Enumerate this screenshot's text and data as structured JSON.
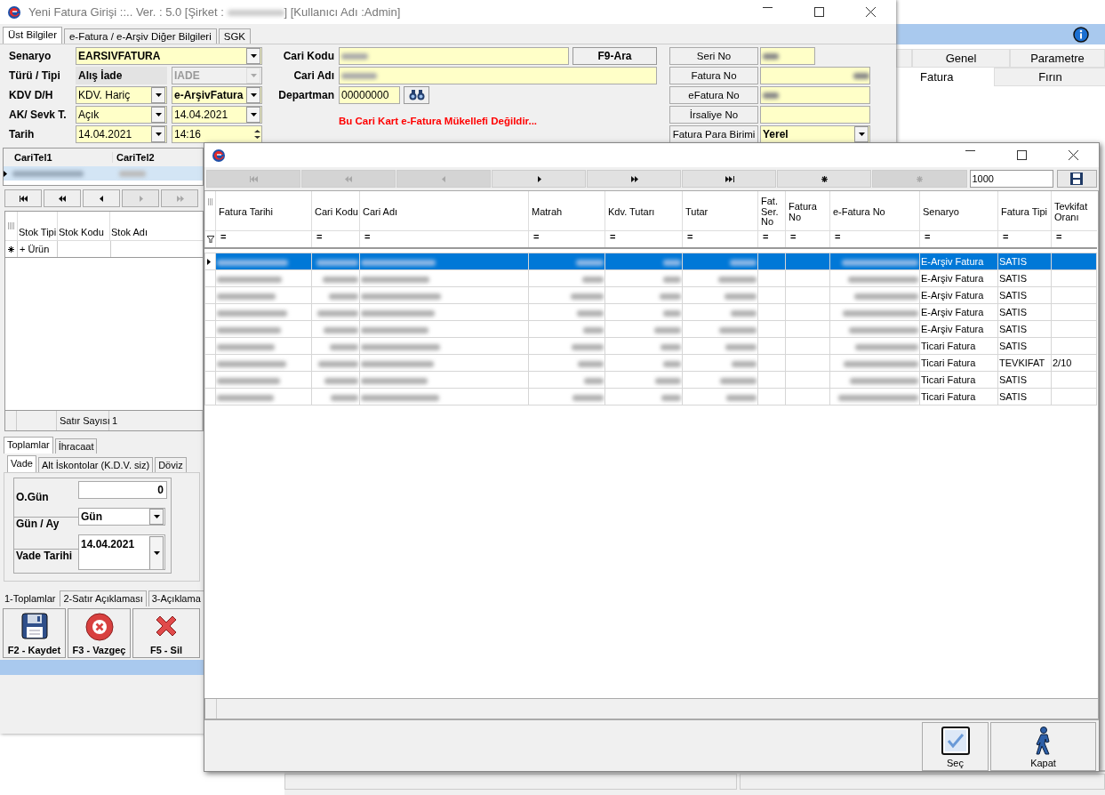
{
  "main_window": {
    "title_prefix": "Yeni Fatura Girişi ::.. Ver. : 5.0 [Şirket : ",
    "title_suffix": "] [Kullanıcı Adı :Admin]",
    "tabs": [
      {
        "label": "Üst Bilgiler",
        "selected": true
      },
      {
        "label": "e-Fatura / e-Arşiv Diğer Bilgileri",
        "selected": false
      },
      {
        "label": "SGK",
        "selected": false
      }
    ],
    "form_left": [
      {
        "label": "Senaryo",
        "fields": [
          {
            "kind": "combo",
            "value": "EARSIVFATURA",
            "disabled": false
          }
        ]
      },
      {
        "label": "Türü / Tipi",
        "fields": [
          {
            "kind": "readonly",
            "value": "Alış İade",
            "disabled": false
          },
          {
            "kind": "combo",
            "value": "IADE",
            "disabled": true
          }
        ]
      },
      {
        "label": "KDV D/H",
        "fields": [
          {
            "kind": "combo",
            "value": "KDV. Hariç",
            "disabled": false
          },
          {
            "kind": "combo",
            "value": "e-ArşivFatura",
            "disabled": false
          }
        ]
      },
      {
        "label": "AK/ Sevk T.",
        "fields": [
          {
            "kind": "combo",
            "value": "Açık",
            "disabled": false
          },
          {
            "kind": "combo",
            "value": "14.04.2021",
            "disabled": false
          }
        ]
      },
      {
        "label": "Tarih",
        "fields": [
          {
            "kind": "combo",
            "value": "14.04.2021",
            "disabled": false
          },
          {
            "kind": "spin",
            "value": "14:16",
            "disabled": false
          }
        ]
      }
    ],
    "form_middle": {
      "cari_kodu_label": "Cari Kodu",
      "search_button": "F9-Ara",
      "cari_adi_label": "Cari Adı",
      "departman_label": "Departman",
      "departman_value": "00000000",
      "warning": "Bu Cari Kart e-Fatura Mükellefi Değildir..."
    },
    "form_right": [
      {
        "label": "Seri No",
        "kind": "blurred"
      },
      {
        "label": "Fatura No",
        "kind": "blurred"
      },
      {
        "label": "eFatura No",
        "kind": "blurred"
      },
      {
        "label": "İrsaliye No",
        "kind": "empty"
      },
      {
        "label": "Fatura Para Birimi",
        "kind": "combo",
        "value": "Yerel"
      }
    ],
    "cari_grid": {
      "columns": [
        "CariTel1",
        "CariTel2"
      ]
    },
    "nav": [
      {
        "kind": "first",
        "disabled": false
      },
      {
        "kind": "prev_page",
        "disabled": false
      },
      {
        "kind": "prev",
        "disabled": false
      },
      {
        "kind": "next",
        "disabled": true
      },
      {
        "kind": "next_page",
        "disabled": true
      }
    ],
    "stock_grid": {
      "columns": [
        "Stok Tipi",
        "Stok Kodu",
        "Stok Adı"
      ],
      "new_row": "+ Ürün",
      "footer_label": "Satır Sayısı",
      "footer_value": "1"
    },
    "totals_tabs": [
      {
        "label": "Toplamlar",
        "selected": true
      },
      {
        "label": "İhracaat",
        "selected": false
      }
    ],
    "vade_tabs": [
      {
        "label": "Vade",
        "selected": true
      },
      {
        "label": "Alt İskontolar (K.D.V. siz)",
        "selected": false
      },
      {
        "label": "Döviz",
        "selected": false
      }
    ],
    "vade_form": {
      "o_gun_label": "O.Gün",
      "o_gun_value": "0",
      "gun_ay_label": "Gün / Ay",
      "gun_ay_value": "Gün",
      "vade_tarihi_label": "Vade Tarihi",
      "vade_tarihi_value": "14.04.2021"
    },
    "bottom_tabs": [
      {
        "label": "1-Toplamlar",
        "selected": true
      },
      {
        "label": "2-Satır Açıklaması",
        "selected": false
      },
      {
        "label": "3-Açıklama",
        "selected": false
      }
    ],
    "actions": [
      {
        "kind": "save",
        "label": "F2 - Kaydet"
      },
      {
        "kind": "cancel",
        "label": "F3 - Vazgeç"
      },
      {
        "kind": "delete",
        "label": "F5 - Sil"
      }
    ]
  },
  "dialog": {
    "nav": [
      {
        "kind": "first",
        "disabled": true
      },
      {
        "kind": "prev_page",
        "disabled": true
      },
      {
        "kind": "prev",
        "disabled": true
      },
      {
        "kind": "next",
        "disabled": false
      },
      {
        "kind": "next_page",
        "disabled": false
      },
      {
        "kind": "last",
        "disabled": false
      },
      {
        "kind": "insert",
        "disabled": false
      },
      {
        "kind": "cancel",
        "disabled": true
      }
    ],
    "page_size": "1000",
    "columns": [
      {
        "label": "Fatura Tarihi",
        "filter": "="
      },
      {
        "label": "Cari Kodu",
        "filter": "="
      },
      {
        "label": "Cari Adı",
        "filter": "="
      },
      {
        "label": "Matrah",
        "filter": "="
      },
      {
        "label": "Kdv. Tutarı",
        "filter": "="
      },
      {
        "label": "Tutar",
        "filter": "="
      },
      {
        "label": "Fat. Ser. No",
        "filter": "="
      },
      {
        "label": "Fatura No",
        "filter": "="
      },
      {
        "label": "e-Fatura No",
        "filter": "="
      },
      {
        "label": "Senaryo",
        "filter": "="
      },
      {
        "label": "Fatura Tipi",
        "filter": "="
      },
      {
        "label": "Tevkifat Oranı",
        "filter": "="
      }
    ],
    "rows": [
      {
        "selected": true,
        "senaryo": "E-Arşiv Fatura",
        "fatura_tipi": "SATIS"
      },
      {
        "selected": false,
        "senaryo": "E-Arşiv Fatura",
        "fatura_tipi": "SATIS"
      },
      {
        "selected": false,
        "senaryo": "E-Arşiv Fatura",
        "fatura_tipi": "SATIS"
      },
      {
        "selected": false,
        "senaryo": "E-Arşiv Fatura",
        "fatura_tipi": "SATIS"
      },
      {
        "selected": false,
        "senaryo": "E-Arşiv Fatura",
        "fatura_tipi": "SATIS"
      },
      {
        "selected": false,
        "senaryo": "Ticari Fatura",
        "fatura_tipi": "SATIS"
      },
      {
        "selected": false,
        "senaryo": "Ticari Fatura",
        "fatura_tipi": "TEVKIFAT",
        "tevkifat_orani": "2/10"
      },
      {
        "selected": false,
        "senaryo": "Ticari Fatura",
        "fatura_tipi": "SATIS"
      },
      {
        "selected": false,
        "senaryo": "Ticari Fatura",
        "fatura_tipi": "SATIS"
      }
    ],
    "buttons": [
      {
        "kind": "select",
        "label": "Seç"
      },
      {
        "kind": "close",
        "label": "Kapat"
      }
    ]
  },
  "back_app": {
    "tabs_row1": [
      {
        "label": "Genel",
        "selected": false
      },
      {
        "label": "Parametre",
        "selected": false
      }
    ],
    "tabs_row2": [
      {
        "label": "Fatura",
        "selected": true
      },
      {
        "label": "Fırın",
        "selected": false
      }
    ]
  }
}
